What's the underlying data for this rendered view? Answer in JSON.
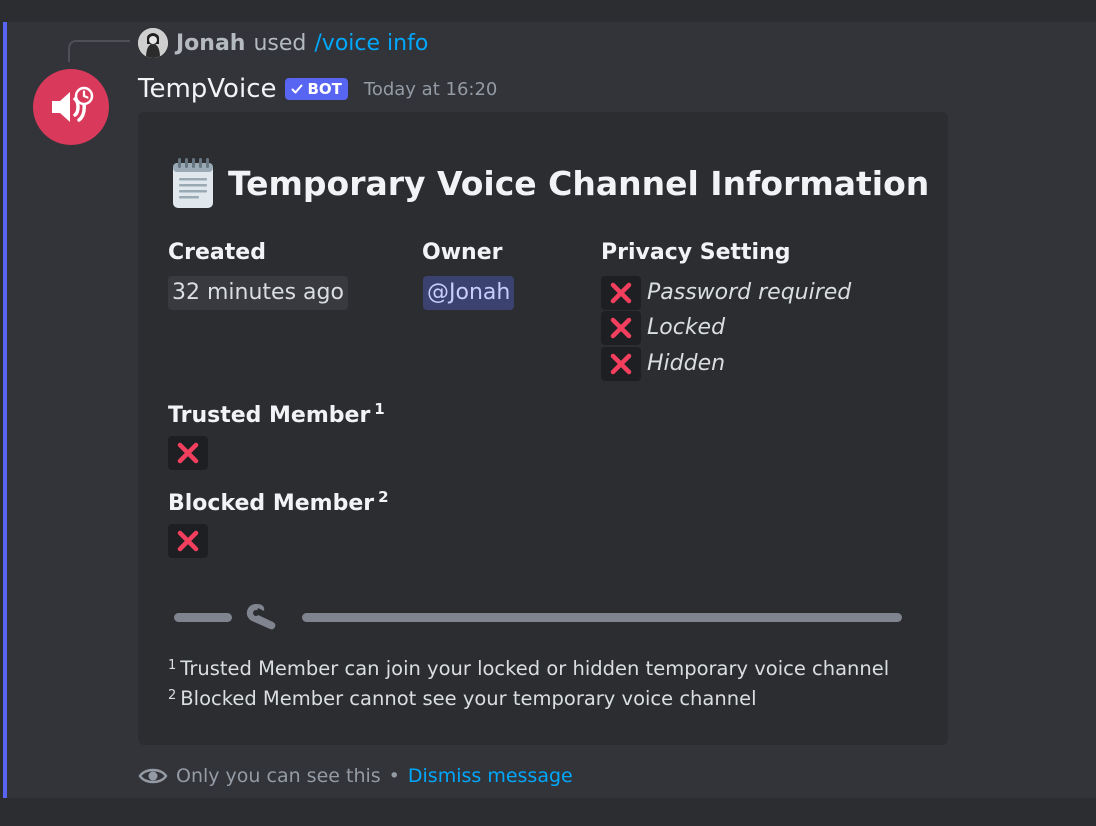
{
  "reply": {
    "user": "Jonah",
    "used_text": "used",
    "command": "/voice info"
  },
  "message": {
    "author": "TempVoice",
    "bot_tag": "BOT",
    "timestamp": "Today at 16:20"
  },
  "embed": {
    "title": "Temporary Voice Channel Information",
    "title_icon": "notepad-icon",
    "fields": {
      "created": {
        "name": "Created",
        "value": "32 minutes ago"
      },
      "owner": {
        "name": "Owner",
        "value": "@Jonah"
      },
      "privacy": {
        "name": "Privacy Setting",
        "items": [
          {
            "state_icon": "cross-icon",
            "label": "Password required"
          },
          {
            "state_icon": "cross-icon",
            "label": "Locked"
          },
          {
            "state_icon": "cross-icon",
            "label": "Hidden"
          }
        ]
      },
      "trusted": {
        "name": "Trusted Member",
        "note_mark": "1",
        "state_icon": "cross-icon"
      },
      "blocked": {
        "name": "Blocked Member",
        "note_mark": "2",
        "state_icon": "cross-icon"
      }
    },
    "divider_icon": "wrench-icon",
    "footnotes": [
      {
        "mark": "1",
        "text": "Trusted Member can join your locked or hidden temporary voice channel"
      },
      {
        "mark": "2",
        "text": "Blocked Member cannot see your temporary voice channel"
      }
    ]
  },
  "ephemeral": {
    "notice": "Only you can see this",
    "separator": "•",
    "dismiss": "Dismiss message"
  },
  "colors": {
    "accent": "#5865f2",
    "avatar_bg": "#d93a5b",
    "cross": "#f23f5e",
    "link": "#00a8fc"
  }
}
